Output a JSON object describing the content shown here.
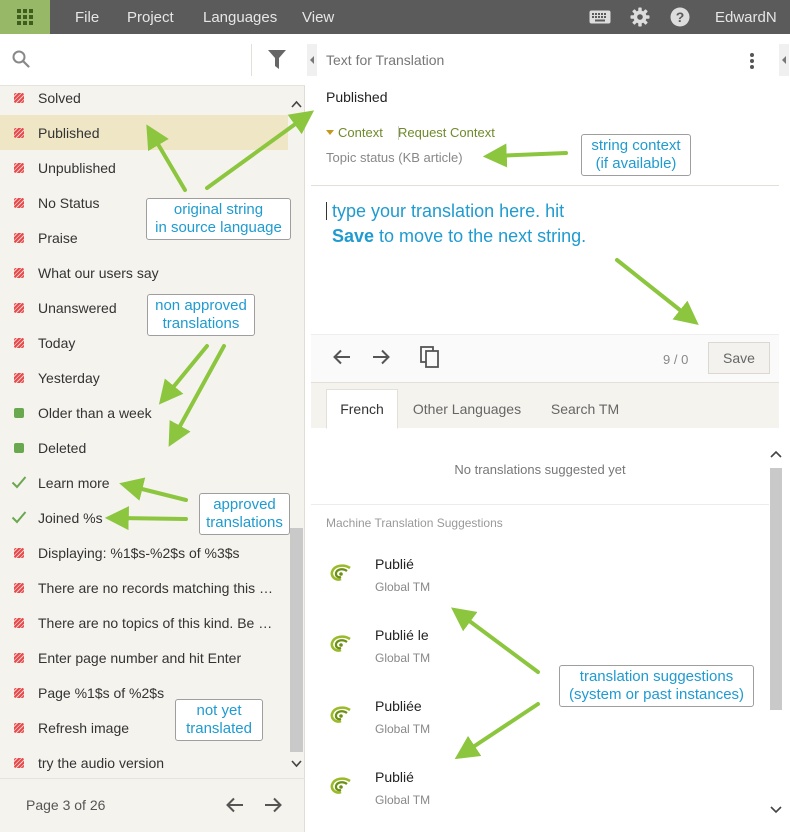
{
  "topbar": {
    "menu": [
      "File",
      "Project",
      "Languages",
      "View"
    ],
    "username": "EdwardN",
    "icons": [
      "apps-grid-icon",
      "keyboard-icon",
      "gear-icon",
      "help-icon"
    ]
  },
  "left": {
    "search_placeholder": "",
    "items": [
      {
        "label": "Solved",
        "status": "untranslated"
      },
      {
        "label": "Published",
        "status": "untranslated",
        "selected": true
      },
      {
        "label": "Unpublished",
        "status": "untranslated"
      },
      {
        "label": "No Status",
        "status": "untranslated"
      },
      {
        "label": "Praise",
        "status": "untranslated"
      },
      {
        "label": "What our users say",
        "status": "untranslated"
      },
      {
        "label": "Unanswered",
        "status": "untranslated"
      },
      {
        "label": "Today",
        "status": "untranslated"
      },
      {
        "label": "Yesterday",
        "status": "untranslated"
      },
      {
        "label": "Older than a week",
        "status": "translated"
      },
      {
        "label": "Deleted",
        "status": "translated"
      },
      {
        "label": "Learn more",
        "status": "approved"
      },
      {
        "label": "Joined %s",
        "status": "approved"
      },
      {
        "label": "Displaying: %1$s-%2$s of %3$s",
        "status": "untranslated"
      },
      {
        "label": "There are no records matching this s...",
        "status": "untranslated"
      },
      {
        "label": "There are no topics of this kind. Be th...",
        "status": "untranslated"
      },
      {
        "label": "Enter page number and hit Enter",
        "status": "untranslated"
      },
      {
        "label": "Page %1$s of %2$s",
        "status": "untranslated"
      },
      {
        "label": "Refresh image",
        "status": "untranslated"
      },
      {
        "label": "try the audio version",
        "status": "untranslated"
      }
    ],
    "pager": "Page 3 of 26"
  },
  "right": {
    "source_title": "Text for Translation",
    "source_text": "Published",
    "context_label": "Context",
    "request_context_label": "Request Context",
    "context_text": "Topic status (KB article)",
    "counter": "9 / 0",
    "save_label": "Save",
    "tabs": [
      "French",
      "Other Languages",
      "Search TM"
    ],
    "no_suggestions": "No translations suggested yet",
    "mt_title": "Machine Translation Suggestions",
    "suggestions": [
      {
        "text": "Publié",
        "source": "Global TM"
      },
      {
        "text": "Publié le",
        "source": "Global TM"
      },
      {
        "text": "Publiée",
        "source": "Global TM"
      },
      {
        "text": "Publié",
        "source": "Global TM"
      }
    ]
  },
  "annotations": {
    "original_string": [
      "original string",
      "in source language"
    ],
    "non_approved": [
      "non approved",
      "translations"
    ],
    "approved": [
      "approved",
      "translations"
    ],
    "not_yet": [
      "not yet",
      "translated"
    ],
    "string_context": [
      "string context",
      "(if available)"
    ],
    "type_here_1": "type your translation here. hit",
    "type_here_bold": "Save",
    "type_here_2": " to move to the next string.",
    "suggestions": [
      "translation suggestions",
      "(system or past instances)"
    ]
  },
  "colors": {
    "accent_green": "#97b967",
    "topbar": "#5b5b5b",
    "annotation_blue": "#1f9bd0",
    "arrow_green": "#8cc63f"
  }
}
